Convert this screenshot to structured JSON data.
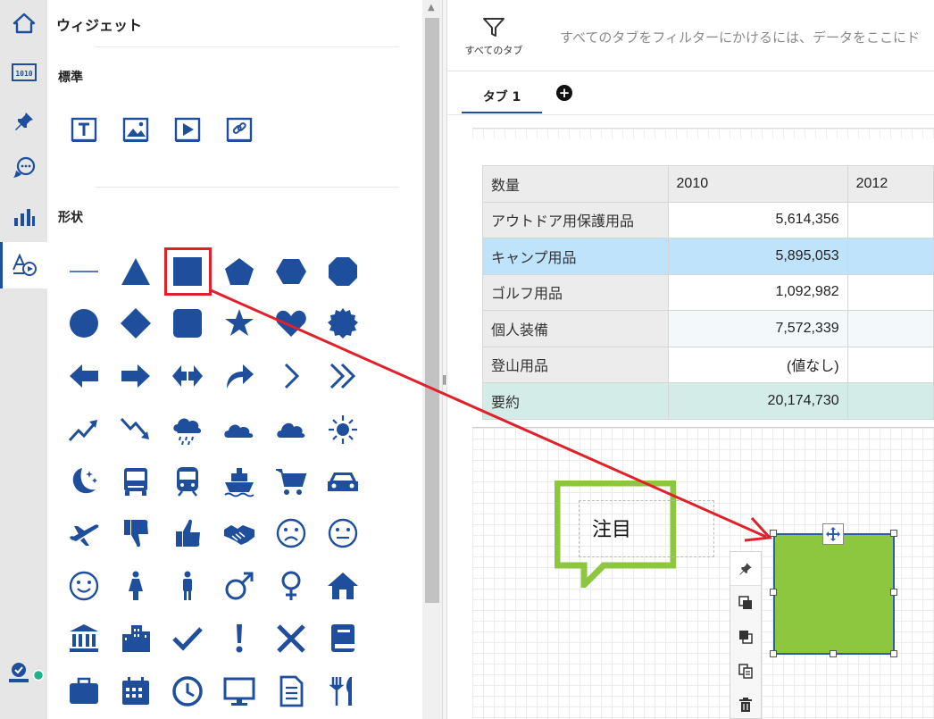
{
  "rail": {
    "items": [
      "home-icon",
      "data-icon",
      "pin-icon",
      "chat-icon",
      "chart-icon",
      "shapes-icon"
    ],
    "footer": "user-check-icon",
    "status_color": "#1db38c"
  },
  "panel": {
    "title": "ウィジェット",
    "section_standard": "標準",
    "section_shapes": "形状",
    "standard_icons": [
      "text-widget-icon",
      "image-widget-icon",
      "video-widget-icon",
      "link-widget-icon"
    ]
  },
  "colors": {
    "accent": "#1f4e9c",
    "highlight": "#e0202a",
    "shape_fill": "#8dc63f",
    "callout": "#8dc63f"
  },
  "main": {
    "filter_label": "すべてのタブ",
    "filter_hint": "すべてのタブをフィルターにかけるには、データをここにド",
    "tab_label": "タブ 1",
    "add_tab": "+"
  },
  "table": {
    "header": [
      "数量",
      "2010",
      "2012"
    ],
    "rows": [
      {
        "label": "アウトドア用保護用品",
        "v2010": "5,614,356",
        "v2012": ""
      },
      {
        "label": "キャンプ用品",
        "v2010": "5,895,053",
        "v2012": ""
      },
      {
        "label": "ゴルフ用品",
        "v2010": "1,092,982",
        "v2012": ""
      },
      {
        "label": "個人装備",
        "v2010": "7,572,339",
        "v2012": ""
      },
      {
        "label": "登山用品",
        "v2010": "(値なし)",
        "v2012": ""
      },
      {
        "label": "要約",
        "v2010": "20,174,730",
        "v2012": ""
      }
    ]
  },
  "callout": {
    "text": "注目"
  },
  "shape_tools": [
    "pin-icon",
    "bring-forward-icon",
    "send-backward-icon",
    "duplicate-icon",
    "delete-icon"
  ]
}
